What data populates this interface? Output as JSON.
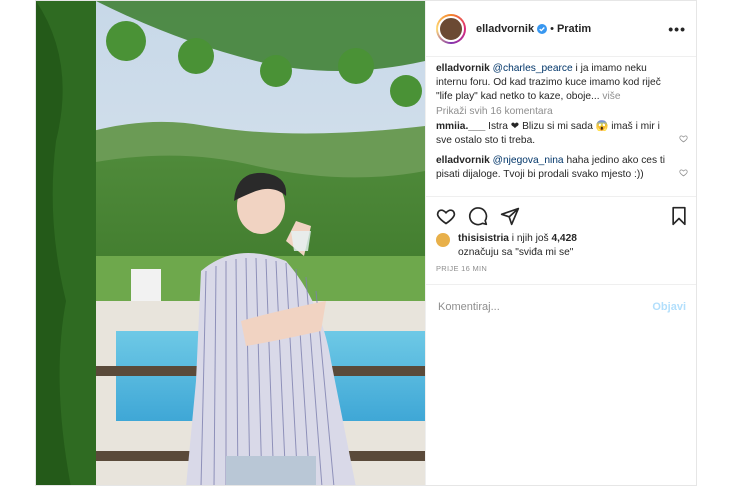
{
  "post": {
    "username": "elladvornik",
    "follow_label": "Pratim",
    "more_label": "•••",
    "caption_mention": "@charles_pearce",
    "caption_text": " i ja imamo neku internu foru. Od kad trazimo kuce imamo kod riječ \"life play\" kad netko to kaze, oboje...",
    "caption_more": " više",
    "view_all": "Prikaži svih 16 komentara"
  },
  "comments": [
    {
      "user": "mmiia.___",
      "text": " Istra ❤ Blizu si mi sada 😱 imaš i mir i sve ostalo sto ti treba."
    },
    {
      "user": "elladvornik",
      "mention": "@njegova_nina",
      "text": " haha jedino ako ces ti pisati dijaloge. Tvoji bi prodali svako mjesto :))"
    }
  ],
  "likes": {
    "user": "thisisistria",
    "text_a": " i njih još ",
    "count": "4,428",
    "text_b": "označuju sa \"sviđa mi se\""
  },
  "time_label": "PRIJE 16 MIN",
  "add_comment": {
    "placeholder": "Komentiraj...",
    "post_label": "Objavi"
  },
  "colors": {
    "accent_blue": "#0095f6",
    "verified": "#3897f0",
    "muted": "#8e8e8e",
    "border": "#efefef"
  },
  "icons": [
    "more-icon",
    "verified-icon",
    "heart-icon",
    "comment-icon",
    "share-icon",
    "save-icon"
  ]
}
